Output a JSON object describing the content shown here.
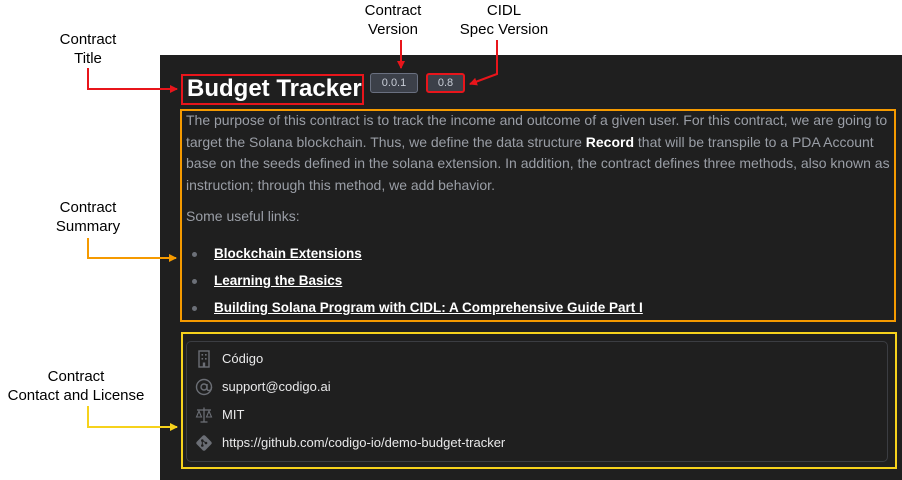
{
  "annotations": {
    "contract_title": "Contract\nTitle",
    "contract_version": "Contract\nVersion",
    "cidl_spec_version": "CIDL\nSpec Version",
    "contract_summary": "Contract\nSummary",
    "contract_contact": "Contract\nContact and License"
  },
  "contract": {
    "title": "Budget Tracker",
    "version": "0.0.1",
    "cidl_version": "0.8",
    "summary_before": "The purpose of this contract is to track the income and outcome of a given user. For this contract, we are going to target the Solana blockchain. Thus, we define the data structure ",
    "summary_bold": "Record",
    "summary_after": " that will be transpile to a PDA Account base on the seeds defined in the solana extension. In addition, the contract defines three methods, also known as instruction; through this method, we add behavior.",
    "links_intro": "Some useful links:",
    "links": [
      "Blockchain Extensions",
      "Learning the Basics",
      "Building Solana Program with CIDL: A Comprehensive Guide Part I"
    ]
  },
  "contact": {
    "organization": "Código",
    "email": "support@codigo.ai",
    "license": "MIT",
    "repository": "https://github.com/codigo-io/demo-budget-tracker"
  },
  "icons": {
    "organization": "building-icon",
    "email": "at-sign-icon",
    "license": "scale-icon",
    "repository": "git-icon"
  },
  "colors": {
    "panel_bg": "#1f1f1f",
    "title_annotation": "#e8151b",
    "summary_annotation": "#f59a00",
    "contact_annotation": "#f6d21c",
    "muted_text": "#9a9ea6",
    "badge_bg": "#3c4049"
  }
}
